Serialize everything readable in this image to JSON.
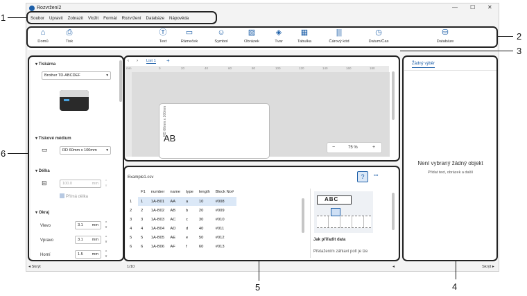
{
  "window": {
    "title": "Rozvržení2",
    "controls": [
      "—",
      "☐",
      "✕"
    ]
  },
  "menu": [
    "Soubor",
    "Upravit",
    "Zobrazit",
    "Vložit",
    "Formát",
    "Rozvržení",
    "Databáze",
    "Nápověda"
  ],
  "toolbar": {
    "home": "Domů",
    "print": "Tisk",
    "text": "Text",
    "frame": "Rámeček",
    "symbol": "Symbol",
    "image": "Obrázek",
    "shape": "Tvar",
    "table": "Tabulka",
    "barcode": "Čárový kód",
    "datetime": "Datum/Čas",
    "database": "Databáze"
  },
  "left_panel": {
    "printer_section": "Tiskárna",
    "printer_value": "Brother TD-ABCDEF",
    "media_section": "Tiskové médium",
    "media_value": "RD 60mm x 100mm",
    "length_section": "Délka",
    "length_value": "100.0",
    "length_unit": "mm",
    "direct_length": "Přímá délka",
    "margin_section": "Okraj",
    "margins": [
      {
        "label": "Vlevo",
        "value": "3.1",
        "unit": "mm"
      },
      {
        "label": "Vpravo",
        "value": "3.1",
        "unit": "mm"
      },
      {
        "label": "Horní",
        "value": "1.5",
        "unit": "mm"
      }
    ],
    "hide": "Skrýt"
  },
  "canvas": {
    "sheet_tab": "List 1",
    "add_tab": "+",
    "ruler_unit": "mm",
    "ruler_ticks": [
      "0",
      "20",
      "40",
      "60",
      "80",
      "100",
      "120",
      "140",
      "160",
      "180"
    ],
    "vertical_label": "RD 60mm x 100mm",
    "label_text": "AB",
    "zoom": "75 %",
    "zoom_minus": "−",
    "zoom_plus": "+"
  },
  "database": {
    "file": "Example1.csv",
    "help": "?",
    "more": "•••",
    "columns": [
      "F1",
      "number",
      "name",
      "type",
      "length",
      "Block No#"
    ],
    "rows": [
      [
        "1",
        "1A-B01",
        "AA",
        "a",
        "10",
        "#008"
      ],
      [
        "2",
        "1A-B02",
        "AB",
        "b",
        "20",
        "#009"
      ],
      [
        "3",
        "1A-B03",
        "AC",
        "c",
        "30",
        "#010"
      ],
      [
        "4",
        "1A-B04",
        "AD",
        "d",
        "40",
        "#011"
      ],
      [
        "5",
        "1A-B05",
        "AE",
        "e",
        "50",
        "#012"
      ],
      [
        "6",
        "1A-B06",
        "AF",
        "f",
        "60",
        "#013"
      ]
    ],
    "row_numbers": [
      "1",
      "2",
      "3",
      "4",
      "5",
      "6"
    ],
    "page": "1/10",
    "help_image_text": "ABC",
    "help_title": "Jak přiřadit data",
    "help_body": "Přetažením záhlaví polí je lze"
  },
  "right_panel": {
    "tab": "Žádný výběr",
    "empty_title": "Není vybraný žádný objekt",
    "empty_sub": "Přidat text, obrázek a další",
    "hide": "Skrýt"
  },
  "callouts": [
    "1",
    "2",
    "3",
    "4",
    "5",
    "6"
  ],
  "colors": {
    "accent": "#1d5fa8",
    "selection": "#dbe8f7"
  }
}
